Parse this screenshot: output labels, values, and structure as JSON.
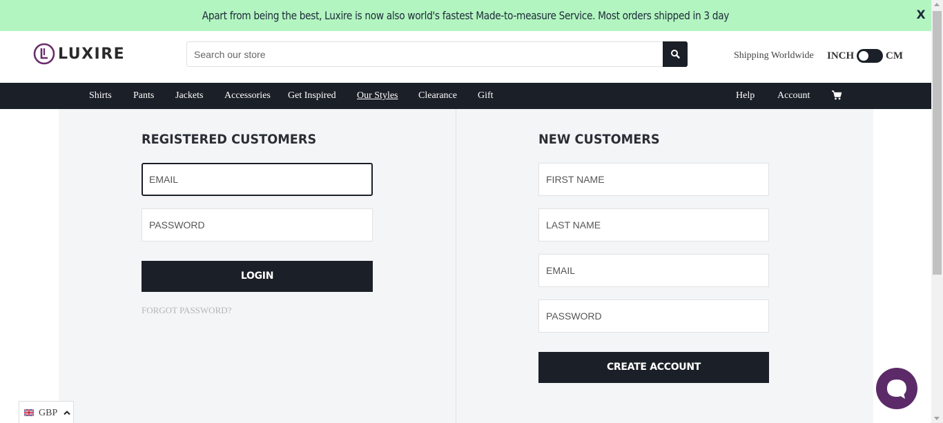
{
  "announcement": {
    "text": "Apart from being the best, Luxire is now also world's fastest Made-to-measure Service. Most orders shipped in 3 day",
    "close_label": "X",
    "bg_color": "#b3f5c0"
  },
  "header": {
    "logo_text": "LUXIRE",
    "logo_icon": "luxire-logo-icon",
    "search": {
      "placeholder": "Search our store",
      "value": "",
      "button_icon": "search-icon"
    },
    "shipping_text": "Shipping Worldwide",
    "unit_toggle": {
      "left_label": "INCH",
      "right_label": "CM",
      "selected": "INCH"
    }
  },
  "nav": {
    "items": [
      {
        "label": "Shirts"
      },
      {
        "label": "Pants"
      },
      {
        "label": "Jackets"
      },
      {
        "label": "Accessories"
      },
      {
        "label": "Get Inspired"
      },
      {
        "label": "Our Styles",
        "active": true
      },
      {
        "label": "Clearance"
      },
      {
        "label": "Gift"
      }
    ],
    "right_items": [
      {
        "label": "Help"
      },
      {
        "label": "Account"
      }
    ],
    "cart_icon": "cart-icon",
    "bg_color": "#1b1f27"
  },
  "registered": {
    "title": "REGISTERED CUSTOMERS",
    "email_placeholder": "EMAIL",
    "password_placeholder": "PASSWORD",
    "login_label": "LOGIN",
    "forgot_label": "FORGOT PASSWORD?"
  },
  "new_customers": {
    "title": "NEW CUSTOMERS",
    "first_name_placeholder": "FIRST NAME",
    "last_name_placeholder": "LAST NAME",
    "email_placeholder": "EMAIL",
    "password_placeholder": "PASSWORD",
    "create_label": "CREATE ACCOUNT"
  },
  "currency": {
    "label": "GBP",
    "flag_icon": "uk-flag-icon",
    "caret_icon": "chevron-up-icon"
  },
  "chat": {
    "icon": "chat-bubble-icon",
    "color": "#5c2a68"
  }
}
